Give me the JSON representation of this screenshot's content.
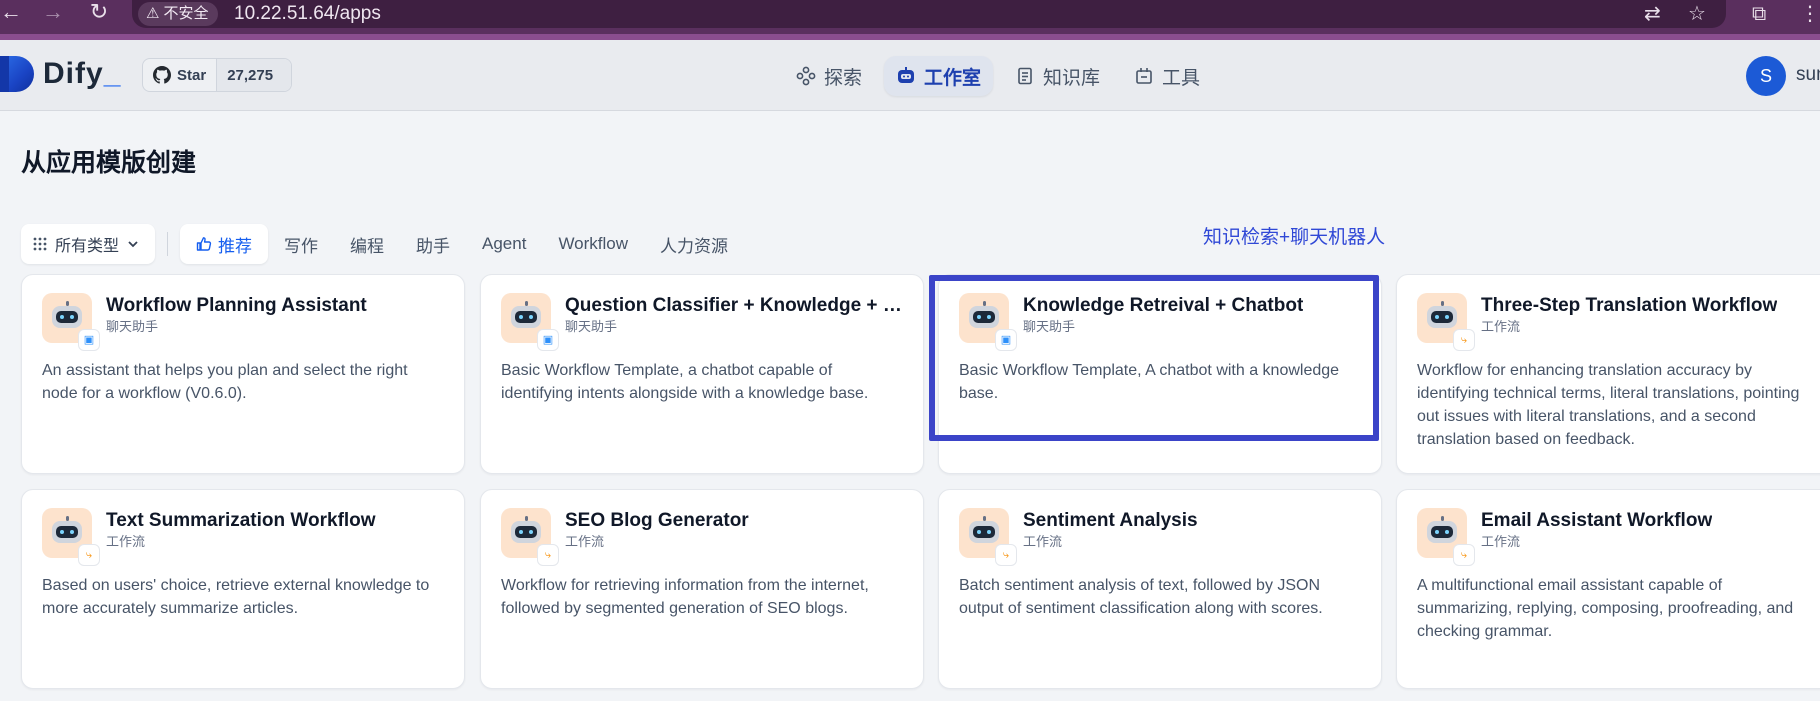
{
  "browser": {
    "security_label": "不安全",
    "url": "10.22.51.64/apps"
  },
  "header": {
    "logo_text": "Dify",
    "github_star_label": "Star",
    "github_star_count": "27,275",
    "nav": [
      {
        "label": "探索",
        "icon": "explore-icon"
      },
      {
        "label": "工作室",
        "icon": "studio-robot-icon",
        "active": true
      },
      {
        "label": "知识库",
        "icon": "knowledge-icon"
      },
      {
        "label": "工具",
        "icon": "tools-icon"
      }
    ],
    "avatar_initial": "S",
    "username": "sun"
  },
  "page": {
    "title": "从应用模版创建",
    "type_filter_label": "所有类型",
    "tabs": [
      "推荐",
      "写作",
      "编程",
      "助手",
      "Agent",
      "Workflow",
      "人力资源"
    ],
    "active_tab": "推荐",
    "annotation": "知识检索+聊天机器人"
  },
  "templates": [
    {
      "title": "Workflow Planning Assistant",
      "type": "聊天助手",
      "badge": "chat",
      "desc": "An assistant that helps you plan and select the right node for a workflow (V0.6.0)."
    },
    {
      "title": "Question Classifier + Knowledge + C...",
      "type": "聊天助手",
      "badge": "chat",
      "desc": "Basic Workflow Template, a chatbot capable of identifying intents alongside with a knowledge base."
    },
    {
      "title": "Knowledge Retreival + Chatbot",
      "type": "聊天助手",
      "badge": "chat",
      "desc": "Basic Workflow Template, A chatbot with a knowledge base.",
      "highlighted": true
    },
    {
      "title": "Three-Step Translation Workflow",
      "type": "工作流",
      "badge": "flow",
      "desc": "Workflow for enhancing translation accuracy by identifying technical terms, literal translations, pointing out issues with literal translations, and a second translation based on feedback."
    },
    {
      "title": "Text Summarization Workflow",
      "type": "工作流",
      "badge": "flow",
      "desc": "Based on users' choice, retrieve external knowledge to more accurately summarize articles."
    },
    {
      "title": "SEO Blog Generator",
      "type": "工作流",
      "badge": "flow",
      "desc": "Workflow for retrieving information from the internet, followed by segmented generation of SEO blogs."
    },
    {
      "title": "Sentiment Analysis",
      "type": "工作流",
      "badge": "flow",
      "desc": "Batch sentiment analysis of text, followed by JSON output of sentiment classification along with scores."
    },
    {
      "title": "Email Assistant Workflow",
      "type": "工作流",
      "badge": "flow",
      "desc": "A multifunctional email assistant capable of summarizing, replying, composing, proofreading, and checking grammar."
    }
  ]
}
